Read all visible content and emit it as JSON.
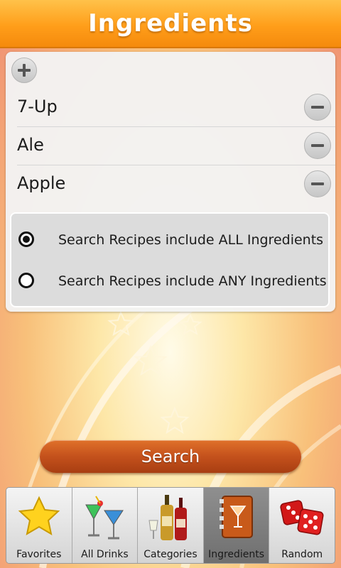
{
  "header": {
    "title": "Ingredients"
  },
  "ingredients": [
    {
      "name": "7-Up"
    },
    {
      "name": "Ale"
    },
    {
      "name": "Apple"
    }
  ],
  "search_mode": {
    "options": [
      {
        "label": "Search Recipes include ALL Ingredients",
        "selected": true
      },
      {
        "label": "Search Recipes include ANY Ingredients",
        "selected": false
      }
    ]
  },
  "search_button": {
    "label": "Search"
  },
  "tabs": [
    {
      "label": "Favorites",
      "icon": "star-icon",
      "active": false
    },
    {
      "label": "All Drinks",
      "icon": "cocktail-glasses-icon",
      "active": false
    },
    {
      "label": "Categories",
      "icon": "bottles-icon",
      "active": false
    },
    {
      "label": "Ingredients",
      "icon": "recipe-book-icon",
      "active": true
    },
    {
      "label": "Random",
      "icon": "dice-icon",
      "active": false
    }
  ],
  "colors": {
    "title_bar": "#ff9e1a",
    "search_button": "#c4511c",
    "active_tab": "#7f7f7f"
  }
}
